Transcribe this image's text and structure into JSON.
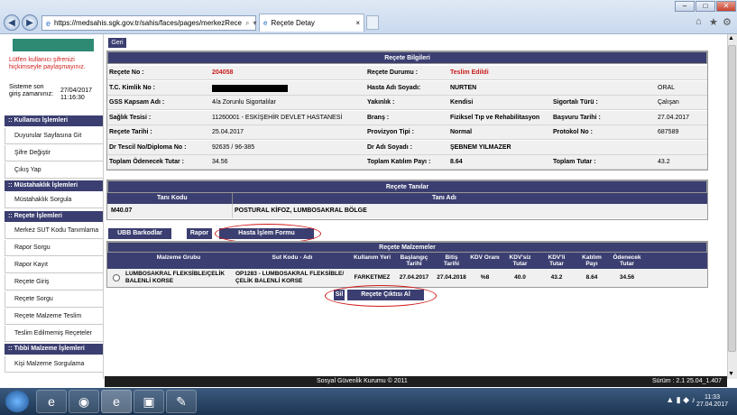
{
  "browser": {
    "url": "https://medsahis.sgk.gov.tr/sahis/faces/pages/merkezRece",
    "tab_title": "Reçete Detay"
  },
  "sidebar": {
    "warning": "Lütfen kullanıcı şifrenizi hiçkimseyle paylaşmayınız.",
    "session_label": "Sisteme son giriş zamanınız:",
    "session_date": "27/04/2017",
    "session_time": "11:16:30",
    "sections": [
      {
        "title": ":: Kullanıcı İşlemleri",
        "items": [
          "Duyurular Sayfasına Git",
          "Şifre Değiştir",
          "Çıkış Yap"
        ]
      },
      {
        "title": ":: Müstahaklık İşlemleri",
        "items": [
          "Müstahaklık Sorgula"
        ]
      },
      {
        "title": ":: Reçete İşlemleri",
        "items": [
          "Merkez SUT Kodu Tanımlama",
          "Rapor Sorgu",
          "Rapor Kayıt",
          "Reçete Giriş",
          "Reçete Sorgu",
          "Reçete Malzeme Teslim",
          "Teslim Edilmemiş Reçeteler"
        ]
      },
      {
        "title": ":: Tıbbi Malzeme İşlemleri",
        "items": [
          "Kişi Malzeme Sorgulama"
        ]
      }
    ]
  },
  "geri_label": "Geri",
  "recete_bilgileri": {
    "title": "Reçete Bilgileri",
    "rows": [
      [
        {
          "l": "Reçete No :",
          "v": "204058",
          "red": true
        },
        {
          "l": "Reçete Durumu :",
          "v": "Teslim Edildi",
          "red": true
        },
        {
          "l": "",
          "v": ""
        }
      ],
      [
        {
          "l": "T.C. Kimlik No :",
          "v": ""
        },
        {
          "l": "Hasta Adı Soyadı:",
          "v": "NURTEN"
        },
        {
          "l": "",
          "v": "ORAL"
        }
      ],
      [
        {
          "l": "GSS Kapsam Adı :",
          "v": "4/a Zorunlu Sigortalılar"
        },
        {
          "l": "Yakınlık :",
          "v": "Kendisi"
        },
        {
          "l": "Sigortalı Türü :",
          "v": "Çalışan"
        }
      ],
      [
        {
          "l": "Sağlık Tesisi :",
          "v": "11260001 - ESKİŞEHİR DEVLET HASTANESİ"
        },
        {
          "l": "Branş :",
          "v": "Fiziksel Tıp ve Rehabilitasyon"
        },
        {
          "l": "Başvuru Tarihi :",
          "v": "27.04.2017"
        }
      ],
      [
        {
          "l": "Reçete Tarihi :",
          "v": "25.04.2017"
        },
        {
          "l": "Provizyon Tipi :",
          "v": "Normal"
        },
        {
          "l": "Protokol No :",
          "v": "687589"
        }
      ],
      [
        {
          "l": "Dr Tescil No/Diploma No :",
          "v": "92635 / 96-385"
        },
        {
          "l": "Dr Adı Soyadı :",
          "v": "ŞEBNEM YILMAZER"
        },
        {
          "l": "",
          "v": ""
        }
      ],
      [
        {
          "l": "Toplam Ödenecek Tutar :",
          "v": "34.56"
        },
        {
          "l": "Toplam Katılım Payı :",
          "v": "8.64"
        },
        {
          "l": "Toplam Tutar :",
          "v": "43.2"
        }
      ]
    ]
  },
  "recete_tanilar": {
    "title": "Reçete Tanılar",
    "col1": "Tanı Kodu",
    "col2": "Tanı Adı",
    "code": "M40.07",
    "name": "POSTURAL KİFOZ, LUMBOSAKRAL BÖLGE"
  },
  "buttons": {
    "ubb": "UBB Barkodlar",
    "rapor": "Rapor",
    "hasta_islem": "Hasta İşlem Formu",
    "sil": "Sil",
    "recete_cikti": "Reçete Çıktısı Al"
  },
  "recete_malzemeler": {
    "title": "Reçete Malzemeler",
    "headers": [
      "Malzeme Grubu",
      "Sut Kodu - Adı",
      "Kullanım Yeri",
      "Başlangıç Tarihi",
      "Bitiş Tarihi",
      "KDV Oranı",
      "KDV'siz Tutar",
      "KDV'li Tutar",
      "Katılım Payı",
      "Ödenecek Tutar"
    ],
    "row": [
      "LUMBOSAKRAL FLEKSİBLE/ÇELİK BALENLİ KORSE",
      "OP1283 - LUMBOSAKRAL FLEKSİBLE/ÇELİK BALENLİ KORSE",
      "FARKETMEZ",
      "27.04.2017",
      "27.04.2018",
      "%8",
      "40.0",
      "43.2",
      "8.64",
      "34.56"
    ]
  },
  "footer": {
    "copyright": "Sosyal Güvenlik Kurumu © 2011",
    "version": "Sürüm : 2.1 25.04_1.407"
  },
  "taskbar": {
    "time": "11:33",
    "date": "27.04.2017"
  },
  "colors": {
    "header_bar": "#3b3e70",
    "accent_red": "#c91a1a",
    "logo_green": "#2f8a74"
  }
}
